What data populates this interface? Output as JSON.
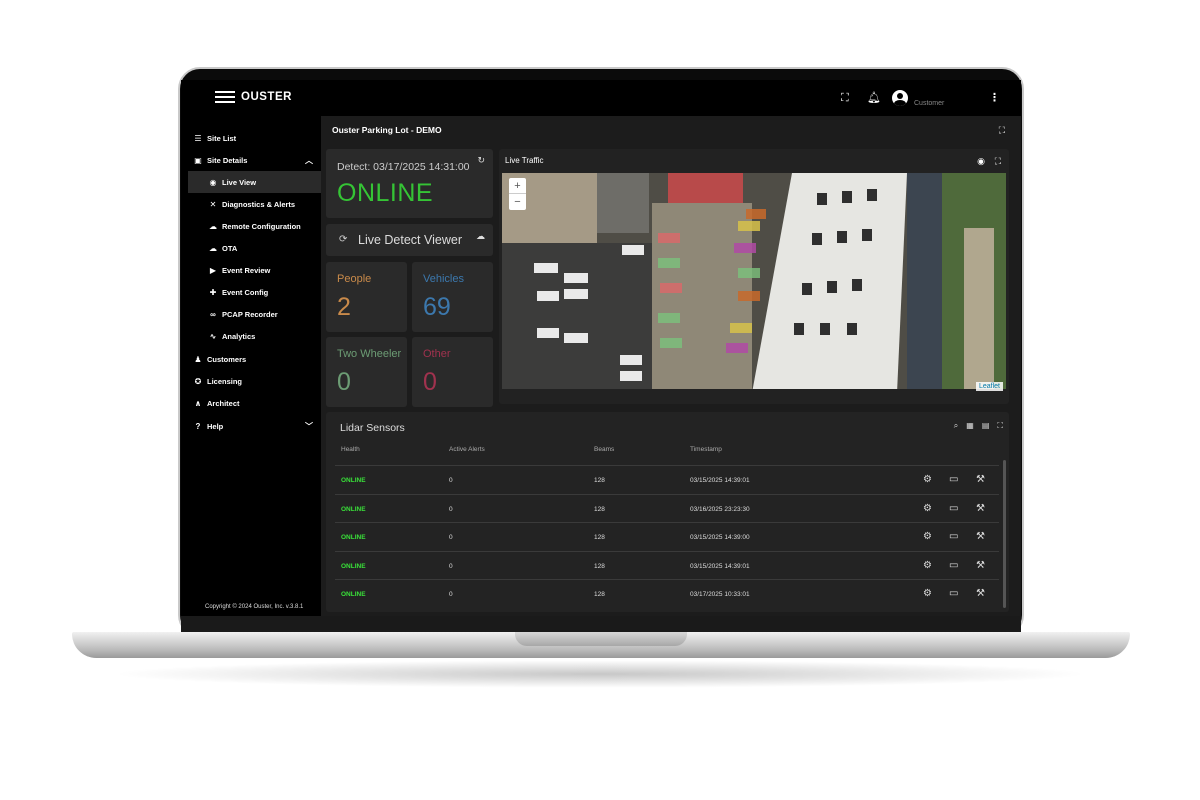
{
  "app": {
    "brand": "OUSTER",
    "user_label": "Customer"
  },
  "sidebar": {
    "items": [
      {
        "label": "Site List",
        "icon": "list-icon",
        "glyph": "☰",
        "level": "top"
      },
      {
        "label": "Site Details",
        "icon": "site-icon",
        "glyph": "▣",
        "level": "top",
        "expanded": true
      },
      {
        "label": "Live View",
        "icon": "eye-icon",
        "glyph": "◉",
        "level": "sub",
        "active": true
      },
      {
        "label": "Diagnostics & Alerts",
        "icon": "tools-icon",
        "glyph": "✕",
        "level": "sub"
      },
      {
        "label": "Remote Configuration",
        "icon": "cloud-gear-icon",
        "glyph": "☁",
        "level": "sub"
      },
      {
        "label": "OTA",
        "icon": "cloud-upload-icon",
        "glyph": "☁",
        "level": "sub"
      },
      {
        "label": "Event Review",
        "icon": "video-icon",
        "glyph": "▶",
        "level": "sub"
      },
      {
        "label": "Event Config",
        "icon": "puzzle-icon",
        "glyph": "✚",
        "level": "sub"
      },
      {
        "label": "PCAP Recorder",
        "icon": "voicemail-icon",
        "glyph": "∞",
        "level": "sub"
      },
      {
        "label": "Analytics",
        "icon": "trend-icon",
        "glyph": "∿",
        "level": "sub"
      },
      {
        "label": "Customers",
        "icon": "people-icon",
        "glyph": "♟",
        "level": "top"
      },
      {
        "label": "Licensing",
        "icon": "license-icon",
        "glyph": "✪",
        "level": "top"
      },
      {
        "label": "Architect",
        "icon": "compass-icon",
        "glyph": "∧",
        "level": "top"
      },
      {
        "label": "Help",
        "icon": "help-icon",
        "glyph": "?",
        "level": "top",
        "collapsible": true
      }
    ],
    "copyright": "Copyright © 2024 Ouster, Inc. v.3.8.1"
  },
  "page": {
    "title": "Ouster Parking Lot - DEMO"
  },
  "detect": {
    "label": "Detect: 03/17/2025 14:31:00",
    "status": "ONLINE"
  },
  "viewer": {
    "label": "Live Detect Viewer"
  },
  "stats": [
    {
      "label": "People",
      "value": "2",
      "color": "#c98a4a"
    },
    {
      "label": "Vehicles",
      "value": "69",
      "color": "#3c78ad"
    },
    {
      "label": "Two Wheeler",
      "value": "0",
      "color": "#6c9c74"
    },
    {
      "label": "Other",
      "value": "0",
      "color": "#a0324e"
    }
  ],
  "traffic": {
    "title": "Live Traffic",
    "attribution": "Leaflet"
  },
  "lidar": {
    "title": "Lidar Sensors",
    "columns": [
      "Health",
      "Active Alerts",
      "Beams",
      "Timestamp"
    ],
    "rows": [
      {
        "health": "ONLINE",
        "alerts": "0",
        "beams": "128",
        "timestamp": "03/15/2025 14:39:01"
      },
      {
        "health": "ONLINE",
        "alerts": "0",
        "beams": "128",
        "timestamp": "03/16/2025 23:23:30"
      },
      {
        "health": "ONLINE",
        "alerts": "0",
        "beams": "128",
        "timestamp": "03/15/2025 14:39:00"
      },
      {
        "health": "ONLINE",
        "alerts": "0",
        "beams": "128",
        "timestamp": "03/15/2025 14:39:01"
      },
      {
        "health": "ONLINE",
        "alerts": "0",
        "beams": "128",
        "timestamp": "03/17/2025 10:33:01"
      }
    ]
  },
  "colors": {
    "online": "#39e039",
    "accent_bg": "#2a2a2a"
  }
}
